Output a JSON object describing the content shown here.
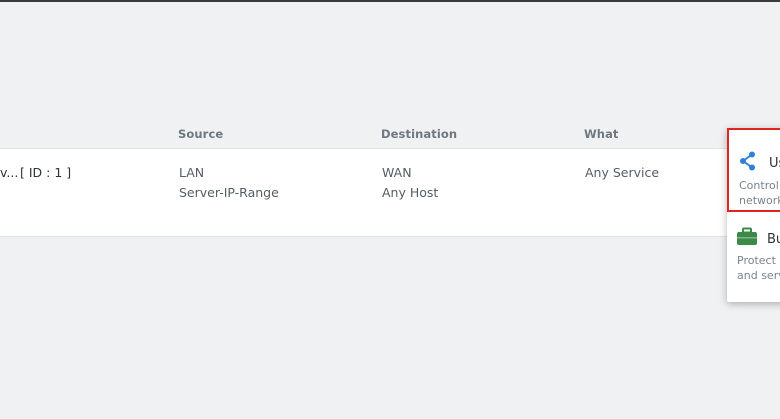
{
  "table": {
    "headers": {
      "source": "Source",
      "destination": "Destination",
      "what": "What"
    },
    "row": {
      "name": "v...",
      "id": "[ ID : 1 ]",
      "source": [
        "LAN",
        "Server-IP-Range"
      ],
      "destination": [
        "WAN",
        "Any Host"
      ],
      "what": "Any Service"
    }
  },
  "popup": {
    "options": [
      {
        "title": "Us",
        "desc_line1": "Control",
        "desc_line2": "network",
        "icon": "share-icon",
        "icon_color": "#2f80d6"
      },
      {
        "title": "Bu",
        "desc_line1": "Protect",
        "desc_line2": "and serv",
        "icon": "briefcase-icon",
        "icon_color": "#3b8a4a"
      }
    ],
    "highlight_color": "#e02424"
  }
}
